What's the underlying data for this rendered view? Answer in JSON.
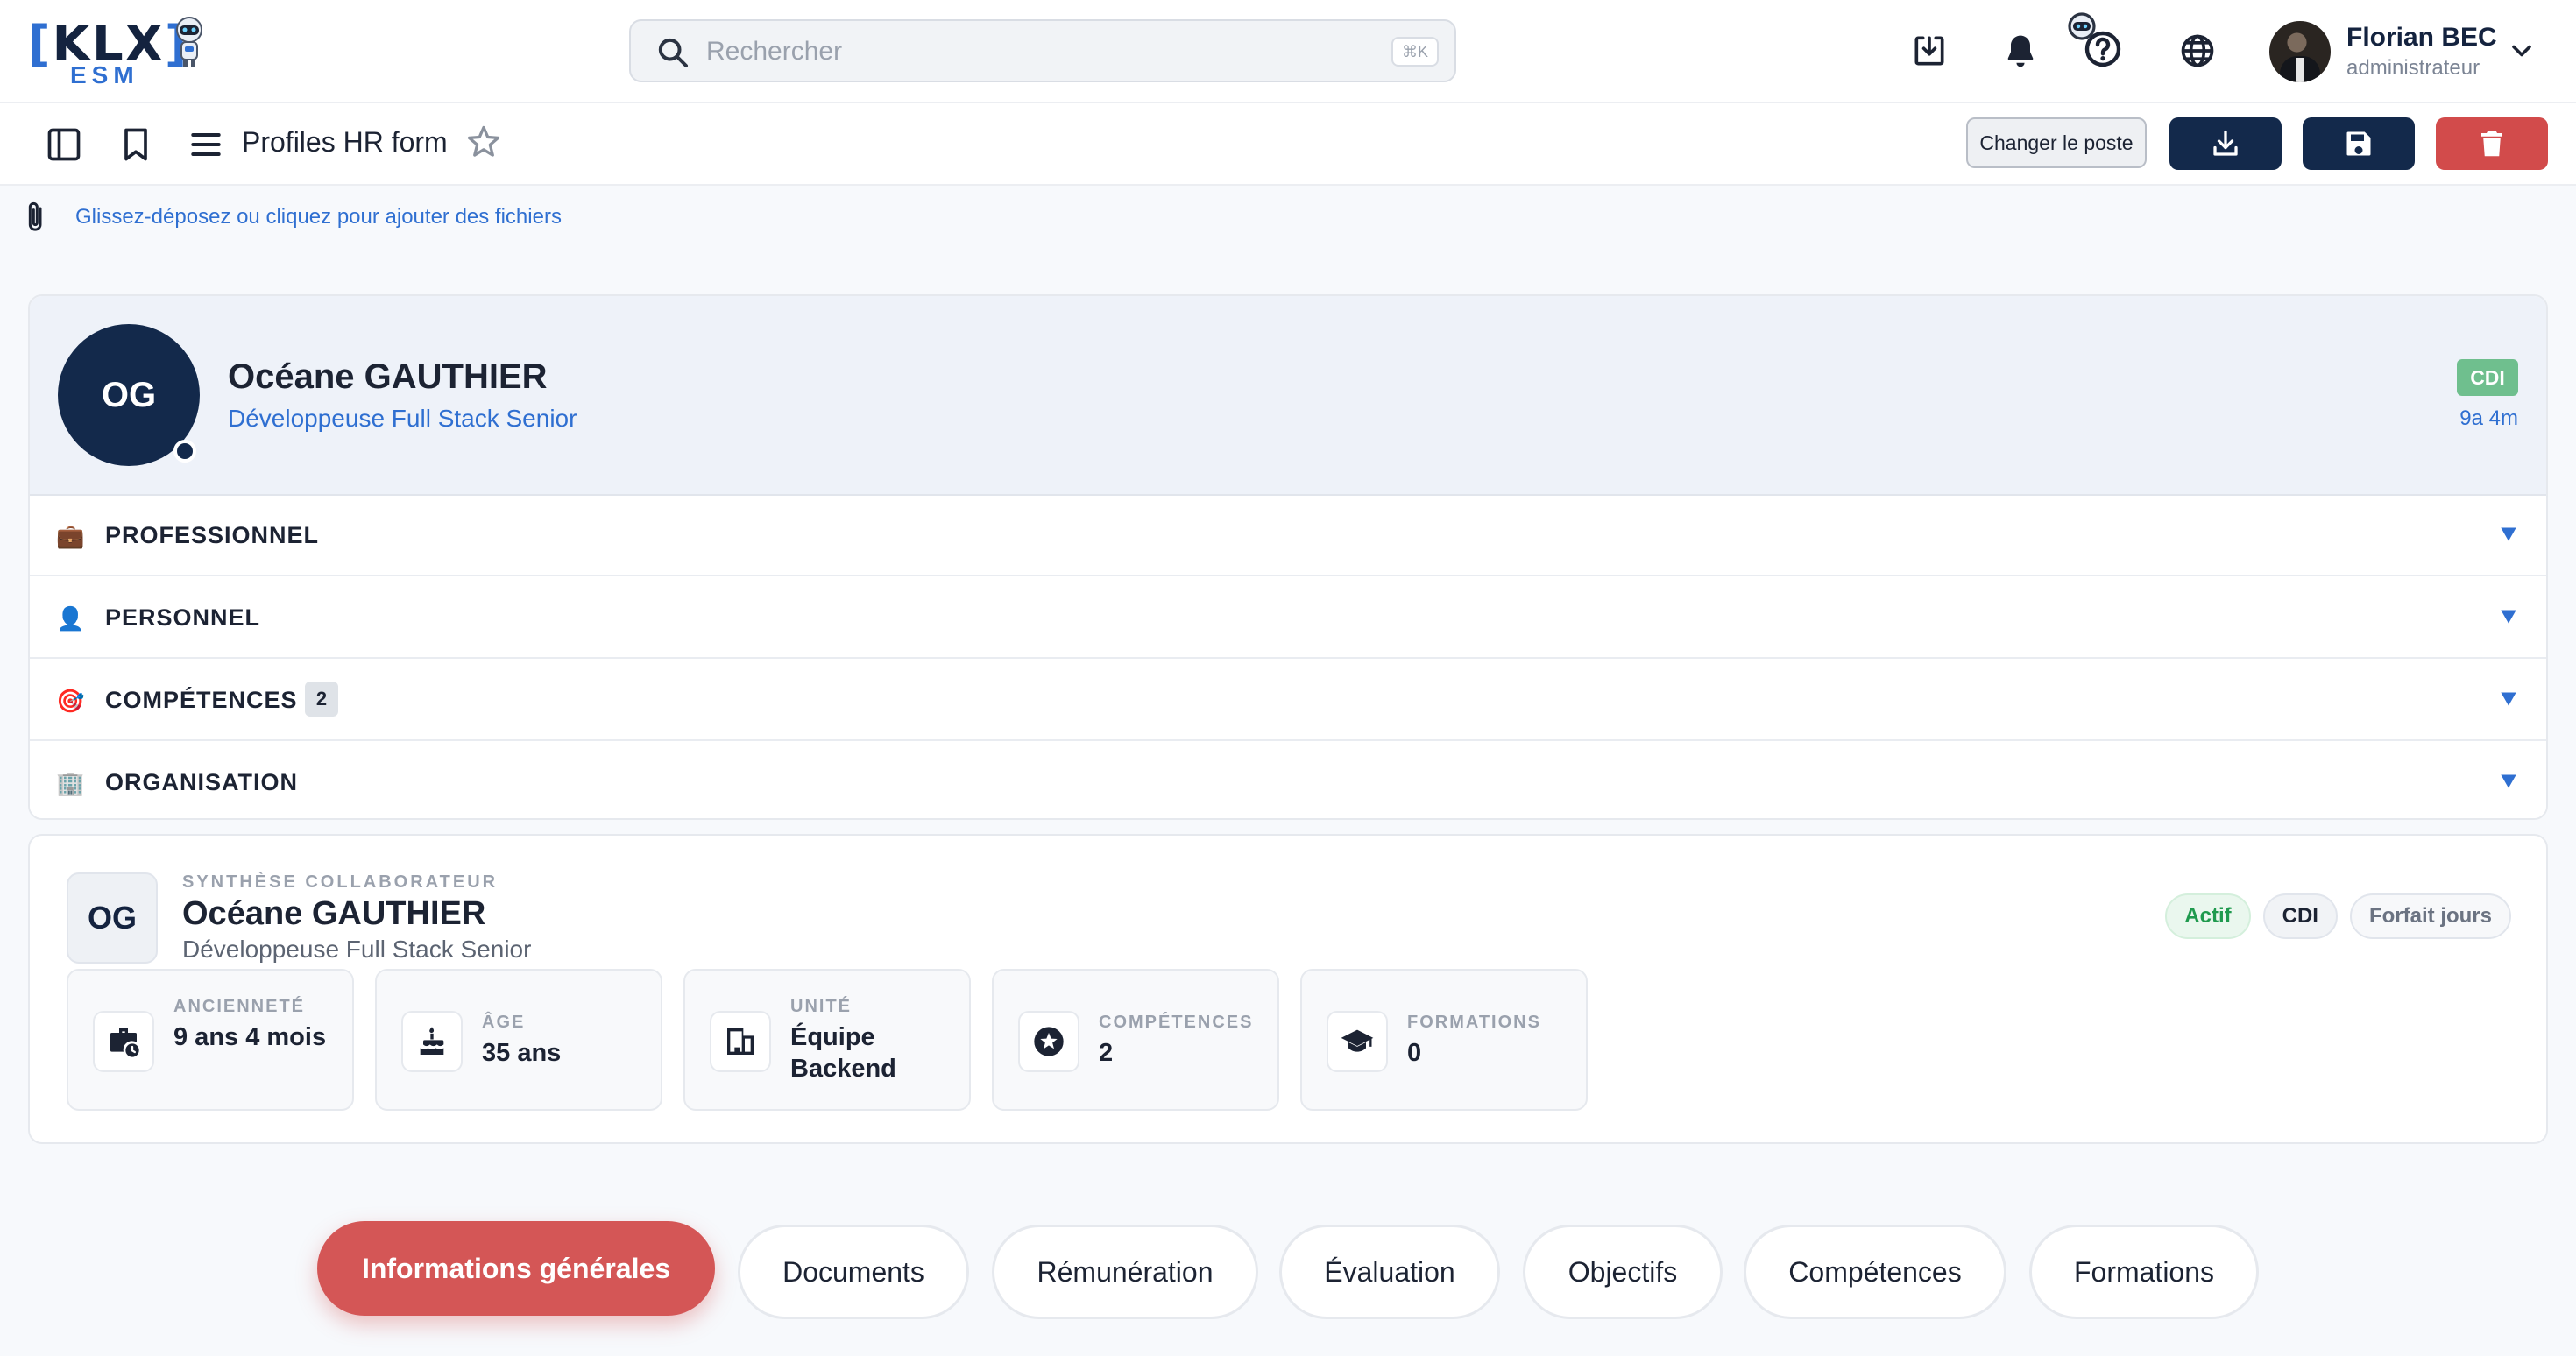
{
  "header": {
    "logo": {
      "bracket_left": "[",
      "text": "KLX",
      "bracket_right": "]",
      "sub": "ESM"
    },
    "search": {
      "placeholder": "Rechercher",
      "shortcut": "⌘K"
    },
    "user": {
      "name": "Florian BEC",
      "role": "administrateur"
    }
  },
  "toolbar": {
    "title": "Profiles HR form",
    "change_position_label": "Changer le poste"
  },
  "attachments": {
    "hint": "Glissez-déposez ou cliquez pour ajouter des fichiers"
  },
  "profile": {
    "initials": "OG",
    "name": "Océane GAUTHIER",
    "job_title": "Développeuse Full Stack Senior",
    "contract": "CDI",
    "tenure": "9a 4m",
    "sections": [
      {
        "emoji": "💼",
        "label": "PROFESSIONNEL"
      },
      {
        "emoji": "👤",
        "label": "PERSONNEL"
      },
      {
        "emoji": "🎯",
        "label": "COMPÉTENCES",
        "count": "2"
      },
      {
        "emoji": "🏢",
        "label": "ORGANISATION"
      }
    ]
  },
  "synthesis": {
    "kicker": "SYNTHÈSE COLLABORATEUR",
    "initials": "OG",
    "name": "Océane GAUTHIER",
    "job_title": "Développeuse Full Stack Senior",
    "chips": [
      "Actif",
      "CDI",
      "Forfait jours"
    ],
    "stats": [
      {
        "icon": "briefcase-clock-icon",
        "label": "ANCIENNETÉ",
        "value": "9 ans 4 mois"
      },
      {
        "icon": "cake-icon",
        "label": "ÂGE",
        "value": "35 ans"
      },
      {
        "icon": "building-icon",
        "label": "UNITÉ",
        "value": "Équipe Backend"
      },
      {
        "icon": "star-badge-icon",
        "label": "COMPÉTENCES",
        "value": "2"
      },
      {
        "icon": "graduation-cap-icon",
        "label": "FORMATIONS",
        "value": "0"
      }
    ]
  },
  "tabs": [
    {
      "label": "Informations générales",
      "active": true
    },
    {
      "label": "Documents"
    },
    {
      "label": "Rémunération"
    },
    {
      "label": "Évaluation"
    },
    {
      "label": "Objectifs"
    },
    {
      "label": "Compétences"
    },
    {
      "label": "Formations"
    }
  ],
  "colors": {
    "navy": "#13294b",
    "accent_blue": "#2f6fd1",
    "danger_red": "#d24b4b",
    "active_tab": "#d45656",
    "success_green": "#1f9a4e"
  }
}
